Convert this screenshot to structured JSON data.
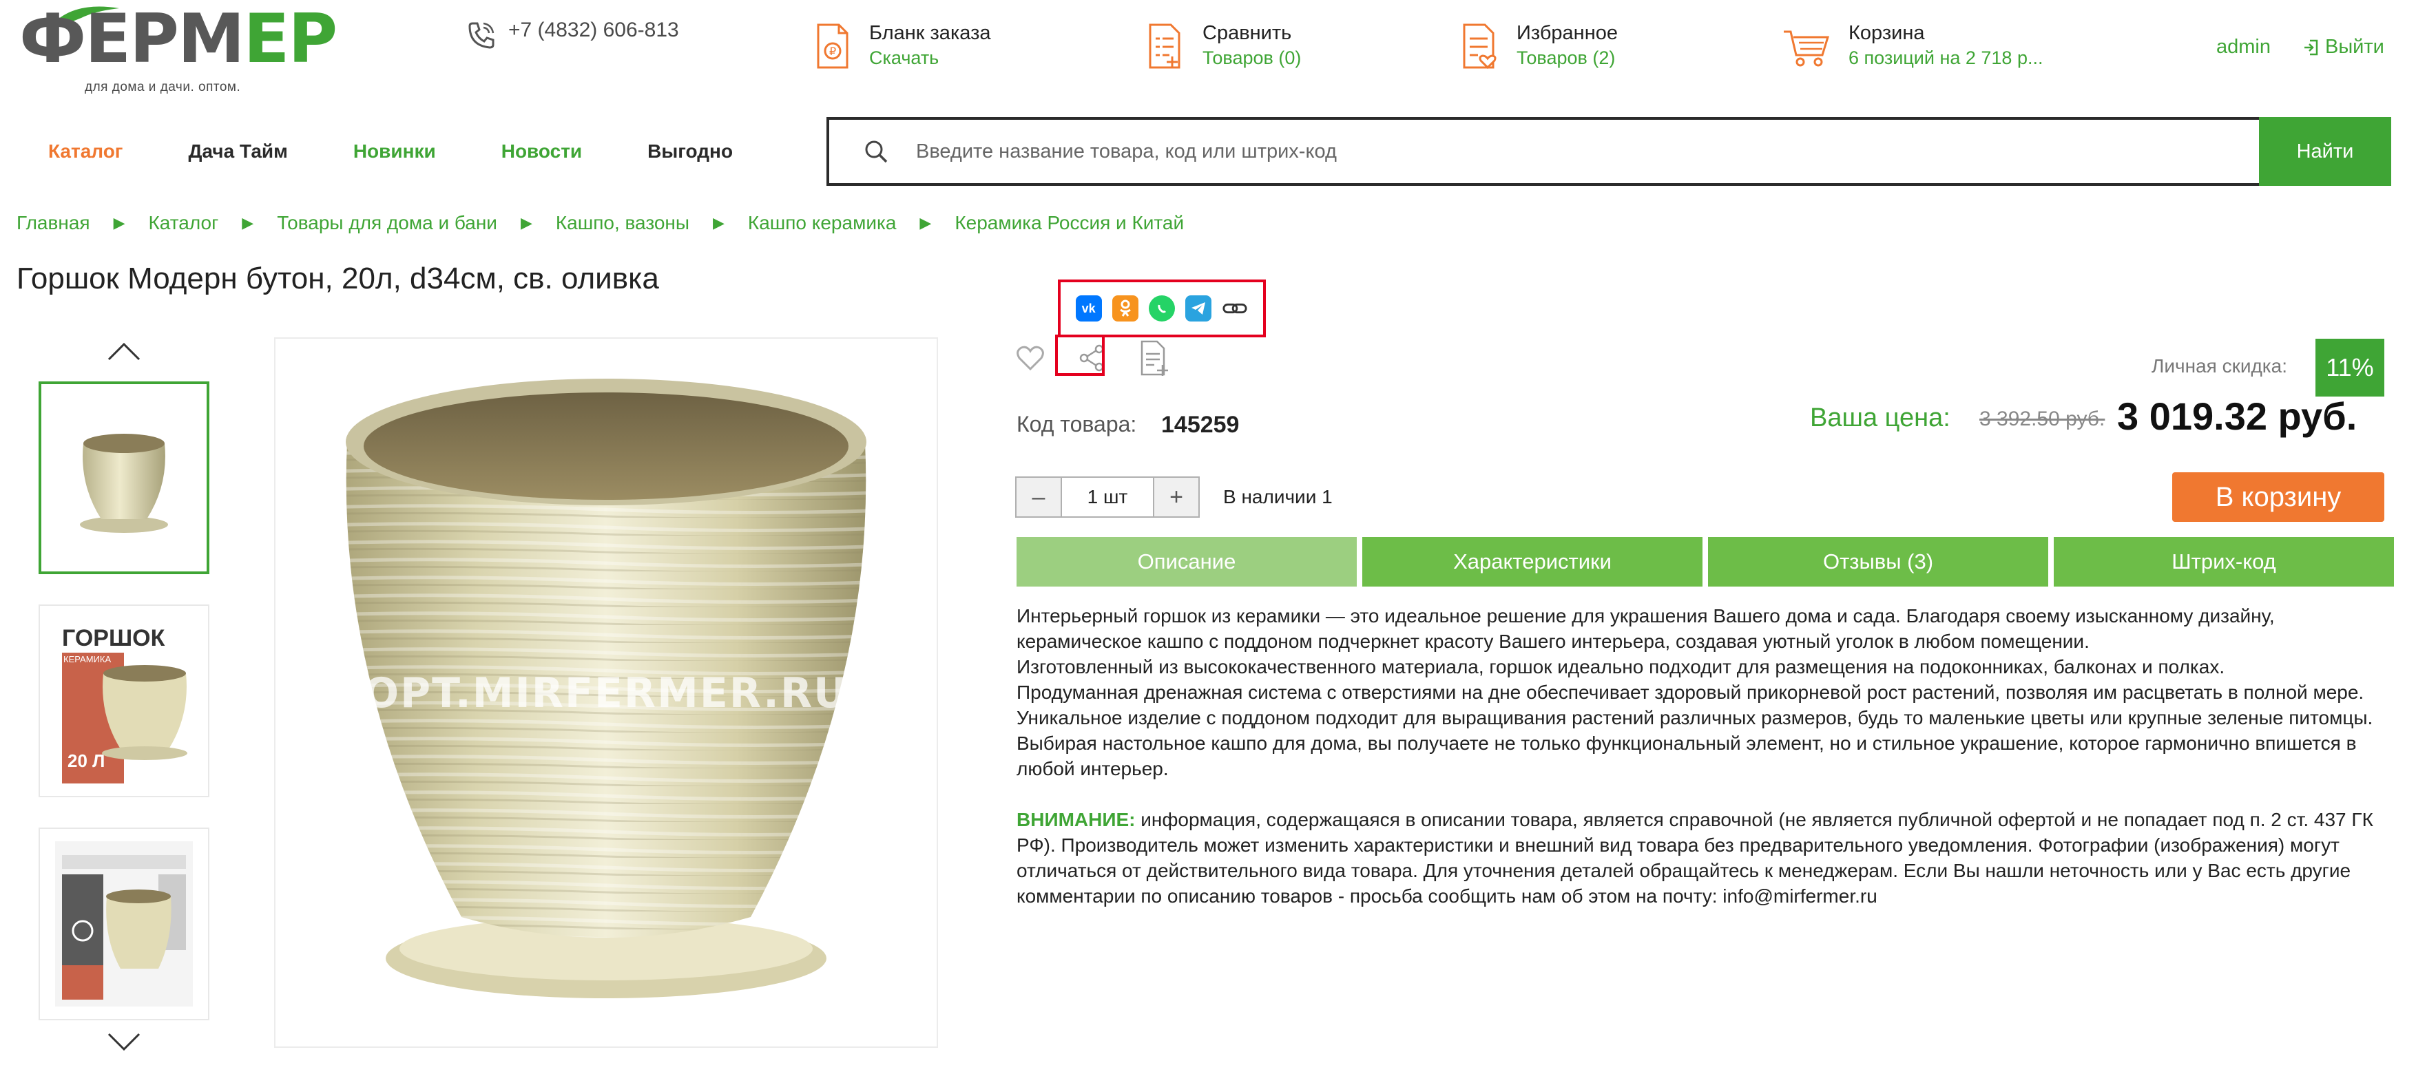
{
  "header": {
    "logo_main_a": "Ф",
    "logo_main_b": "ЕРМ",
    "logo_main_c": "ЕР",
    "logo_sub": "для дома и дачи. оптом.",
    "phone": "+7 (4832) 606-813",
    "order_form": {
      "title": "Бланк заказа",
      "sub": "Скачать"
    },
    "compare": {
      "title": "Сравнить",
      "sub": "Товаров (0)"
    },
    "favorites": {
      "title": "Избранное",
      "sub": "Товаров (2)"
    },
    "cart": {
      "title": "Корзина",
      "sub": "6 позиций на 2 718 р..."
    },
    "admin": "admin",
    "logout": "Выйти"
  },
  "nav": {
    "items": [
      "Каталог",
      "Дача Тайм",
      "Новинки",
      "Новости",
      "Выгодно"
    ]
  },
  "search": {
    "placeholder": "Введите название товара, код или штрих-код",
    "button": "Найти"
  },
  "breadcrumb": [
    "Главная",
    "Каталог",
    "Товары для дома и бани",
    "Кашпо, вазоны",
    "Кашпо керамика",
    "Керамика Россия и Китай"
  ],
  "product": {
    "title": "Горшок Модерн бутон, 20л, d34см, св. оливка",
    "watermark": "OPT.MIRFERMER.RU",
    "thumb2_label": "ГОРШОК",
    "thumb2_sub": "КЕРАМИКА",
    "thumb2_vol": "20 Л",
    "code_label": "Код товара:",
    "code_value": "145259",
    "discount_label": "Личная скидка:",
    "discount_value": "11%",
    "price_label": "Ваша цена:",
    "old_price": "3 392.50 руб.",
    "new_price": "3 019.32 руб.",
    "qty_value": "1 шт",
    "qty_minus": "–",
    "qty_plus": "+",
    "stock": "В наличии 1",
    "cart_button": "В корзину"
  },
  "share": {
    "icons": [
      "vk-icon",
      "odnoklassniki-icon",
      "whatsapp-icon",
      "telegram-icon",
      "copy-link-icon"
    ],
    "vk_text": "vk",
    "colors": {
      "vk": "#0077ff",
      "ok": "#f7931e",
      "whatsapp": "#25d366",
      "telegram": "#2aa3df",
      "link": "#333333"
    }
  },
  "tabs": [
    "Описание",
    "Характеристики",
    "Отзывы (3)",
    "Штрих-код"
  ],
  "description": {
    "p1": "Интерьерный горшок из керамики — это идеальное решение для украшения Вашего дома и сада. Благодаря своему изысканному дизайну, керамическое кашпо с поддоном подчеркнет красоту Вашего интерьера, создавая уютный уголок в любом помещении.",
    "p2": "Изготовленный из высококачественного материала, горшок идеально подходит для размещения на подоконниках, балконах и полках.",
    "p3": "Продуманная дренажная система с отверстиями на дне обеспечивает здоровый прикорневой рост растений, позволяя им расцветать в полной мере. Уникальное изделие с поддоном подходит для выращивания растений различных размеров, будь то маленькие цветы или крупные зеленые питомцы.",
    "p4": "Выбирая настольное кашпо для дома, вы получаете не только функциональный элемент, но и стильное украшение, которое гармонично впишется в любой интерьер.",
    "warn_label": "ВНИМАНИЕ:",
    "warn_text": " информация, содержащаяся в описании товара, является справочной (не является публичной офертой и не попадает под п. 2 ст. 437 ГК РФ). Производитель может изменить характеристики и внешний вид товара без предварительного уведомления. Фотографии (изображения) могут отличаться от действительного вида товара. Для уточнения деталей обращайтесь к менеджерам. Если Вы нашли неточность или у Вас есть другие комментарии по описанию товаров - просьба сообщить нам об этом на почту: info@mirfermer.ru"
  },
  "colors": {
    "green": "#3fa535",
    "orange": "#f07830",
    "tab": "#6dbd48",
    "tab_active": "#9ccf80",
    "highlight": "#e4001e"
  }
}
